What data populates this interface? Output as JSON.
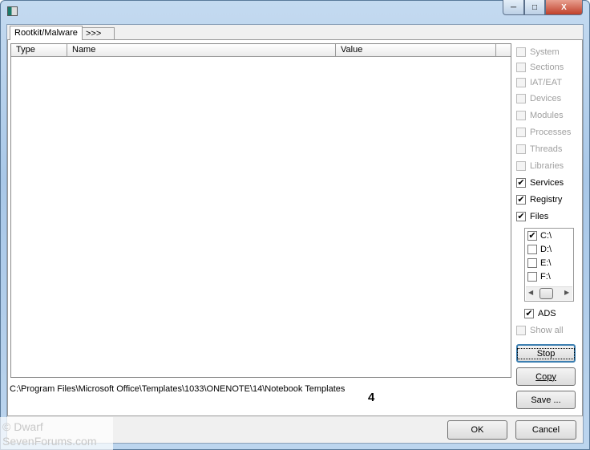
{
  "window": {
    "minimize": "─",
    "maximize": "□",
    "close": "X"
  },
  "tabs": [
    {
      "label": "Rootkit/Malware"
    },
    {
      "label": ">>>"
    }
  ],
  "list": {
    "columns": [
      "Type",
      "Name",
      "Value"
    ]
  },
  "options": [
    {
      "label": "System",
      "checked": false,
      "enabled": false
    },
    {
      "label": "Sections",
      "checked": false,
      "enabled": false
    },
    {
      "label": "IAT/EAT",
      "checked": false,
      "enabled": false
    },
    {
      "label": "Devices",
      "checked": false,
      "enabled": false
    },
    {
      "label": "Modules",
      "checked": false,
      "enabled": false
    },
    {
      "label": "Processes",
      "checked": false,
      "enabled": false
    },
    {
      "label": "Threads",
      "checked": false,
      "enabled": false
    },
    {
      "label": "Libraries",
      "checked": false,
      "enabled": false
    },
    {
      "label": "Services",
      "checked": true,
      "enabled": true
    },
    {
      "label": "Registry",
      "checked": true,
      "enabled": true
    },
    {
      "label": "Files",
      "checked": true,
      "enabled": true
    }
  ],
  "drives": [
    {
      "label": "C:\\",
      "checked": true
    },
    {
      "label": "D:\\",
      "checked": false
    },
    {
      "label": "E:\\",
      "checked": false
    },
    {
      "label": "F:\\",
      "checked": false
    }
  ],
  "ads": {
    "label": "ADS",
    "checked": true
  },
  "show_all": {
    "label": "Show all",
    "checked": false
  },
  "buttons": {
    "stop": "Stop",
    "copy": "Copy",
    "save": "Save ...",
    "ok": "OK",
    "cancel": "Cancel"
  },
  "status": {
    "path": "C:\\Program Files\\Microsoft Office\\Templates\\1033\\ONENOTE\\14\\Notebook Templates",
    "annotation": "4"
  },
  "watermark": [
    "© Dwarf",
    "SevenForums.com"
  ]
}
